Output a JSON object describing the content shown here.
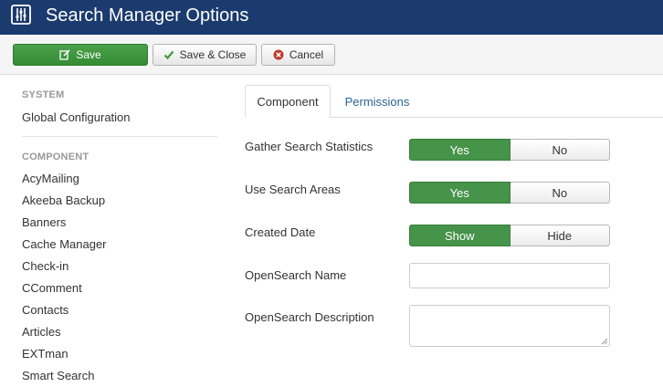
{
  "header": {
    "title": "Search Manager Options",
    "icon": "options-sliders-icon"
  },
  "toolbar": {
    "save_label": "Save",
    "save_close_label": "Save & Close",
    "cancel_label": "Cancel"
  },
  "sidebar": {
    "system_heading": "SYSTEM",
    "system_items": [
      "Global Configuration"
    ],
    "component_heading": "COMPONENT",
    "component_items": [
      "AcyMailing",
      "Akeeba Backup",
      "Banners",
      "Cache Manager",
      "Check-in",
      "CComment",
      "Contacts",
      "Articles",
      "EXTman",
      "Smart Search"
    ]
  },
  "tabs": [
    {
      "label": "Component",
      "active": true
    },
    {
      "label": "Permissions",
      "active": false
    }
  ],
  "form": {
    "gather_stats": {
      "label": "Gather Search Statistics",
      "options": [
        "Yes",
        "No"
      ],
      "selected": "Yes"
    },
    "use_areas": {
      "label": "Use Search Areas",
      "options": [
        "Yes",
        "No"
      ],
      "selected": "Yes"
    },
    "created_date": {
      "label": "Created Date",
      "options": [
        "Show",
        "Hide"
      ],
      "selected": "Show"
    },
    "opensearch_name": {
      "label": "OpenSearch Name",
      "value": ""
    },
    "opensearch_desc": {
      "label": "OpenSearch Description",
      "value": ""
    }
  },
  "colors": {
    "header_bg": "#1b3b6f",
    "save_green": "#3f9a3f",
    "toggle_active": "#46934a",
    "link_blue": "#2a6496"
  }
}
